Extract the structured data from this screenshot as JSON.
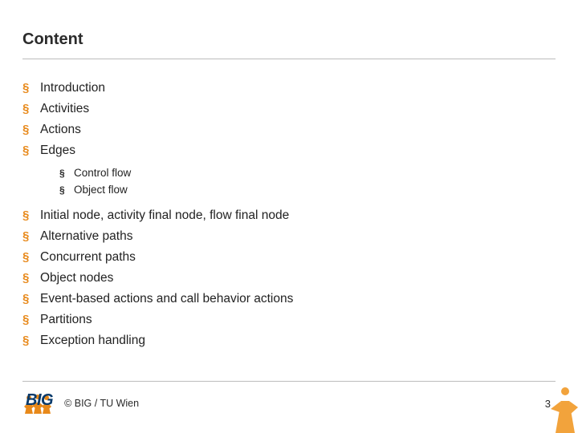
{
  "title": "Content",
  "bullets_top": [
    "Introduction",
    "Activities",
    "Actions",
    "Edges"
  ],
  "bullets_sub": [
    "Control flow",
    "Object flow"
  ],
  "bullets_bottom": [
    "Initial node, activity final node, flow final node",
    "Alternative paths",
    "Concurrent paths",
    "Object nodes",
    "Event-based actions and call behavior actions",
    "Partitions",
    "Exception handling"
  ],
  "footer": {
    "logo_text": "BIG",
    "copyright": "© BIG / TU Wien",
    "page_number": "3"
  },
  "colors": {
    "accent": "#e8891a",
    "logo_blue": "#083a6b"
  }
}
